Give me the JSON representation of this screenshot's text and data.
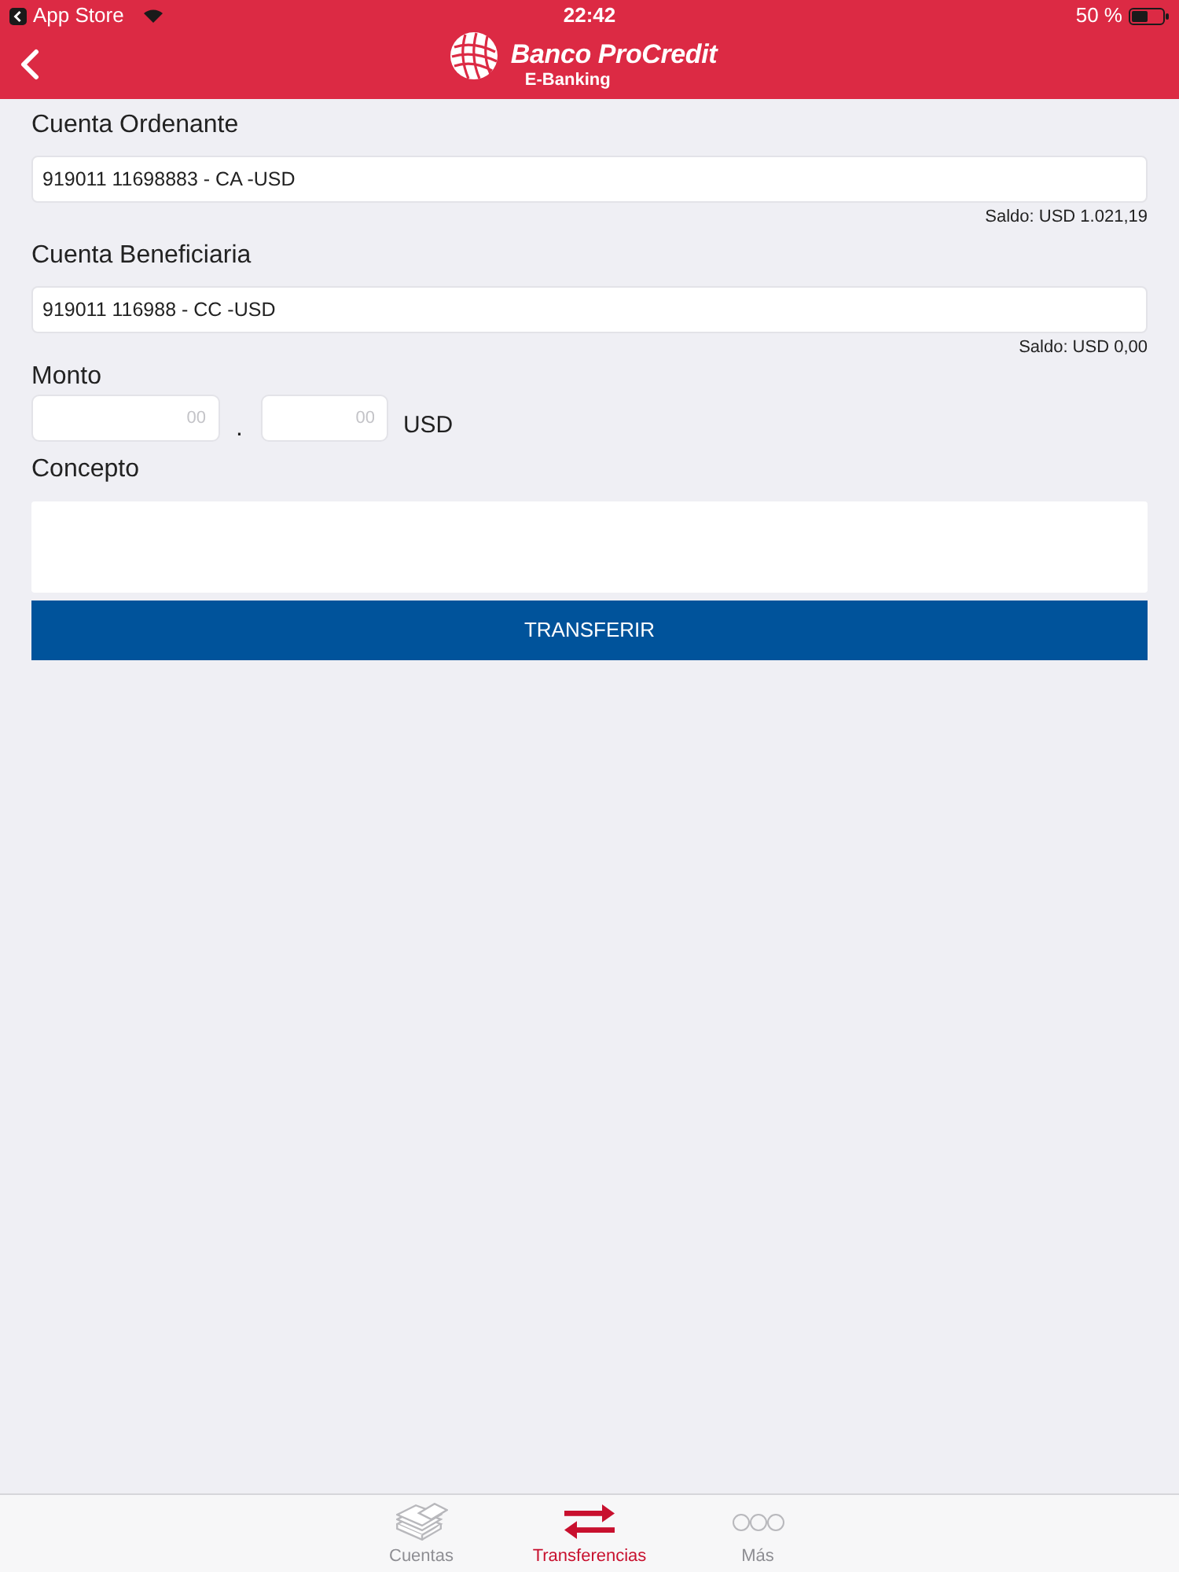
{
  "status_bar": {
    "back_label": "App Store",
    "time": "22:42",
    "battery": "50 %"
  },
  "nav": {
    "brand": "Banco ProCredit",
    "subtitle": "E-Banking"
  },
  "accounts": [
    {
      "label": "Cuenta Ordenante",
      "value": "919011 11698883 - CA -USD",
      "balance": "Saldo: USD 1.021,19"
    },
    {
      "label": "Cuenta Beneficiaria",
      "value": "919011 116988 - CC -USD",
      "balance": "Saldo: USD 0,00"
    }
  ],
  "amount": {
    "label": "Monto",
    "integer_placeholder": "00",
    "decimal_placeholder": "00",
    "separator": ".",
    "currency": "USD"
  },
  "concept": {
    "label": "Concepto"
  },
  "submit": "TRANSFERIR",
  "tab_bar": [
    {
      "label": "Cuentas",
      "selected": false
    },
    {
      "label": "Transferencias",
      "selected": true
    },
    {
      "label": "Más",
      "selected": false
    }
  ]
}
